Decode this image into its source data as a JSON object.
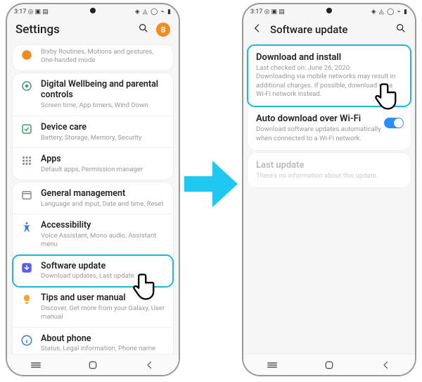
{
  "status": {
    "time": "3:17",
    "left_extra": "◎ ▣ ▤",
    "right": "◈ ◬ ◯ ⌁ ▮"
  },
  "left": {
    "title": "Settings",
    "avatar_initial": "B",
    "rows": [
      {
        "title": "Bixby Routines, Motions and gestures, One-handed mode",
        "sub": "",
        "icon": "bixby",
        "color": "#f28c1e"
      },
      {
        "title": "Digital Wellbeing and parental controls",
        "sub": "Screen time, App timers, Wind Down",
        "icon": "wellbeing",
        "color": "#3aa06e"
      },
      {
        "title": "Device care",
        "sub": "Battery, Storage, Memory, Security",
        "icon": "devicecare",
        "color": "#3aa06e"
      },
      {
        "title": "Apps",
        "sub": "Default apps, Permission manager",
        "icon": "apps",
        "color": "#8a8a8a"
      },
      {
        "title": "General management",
        "sub": "Language and input, Date and time, Reset",
        "icon": "general",
        "color": "#8a8a8a"
      },
      {
        "title": "Accessibility",
        "sub": "Voice Assistant, Mono audio, Assistant menu",
        "icon": "accessibility",
        "color": "#3a7cd6"
      },
      {
        "title": "Software update",
        "sub": "Download updates, Last update",
        "icon": "swupdate",
        "color": "#5c5cf0",
        "highlight": true
      },
      {
        "title": "Tips and user manual",
        "sub": "Discover, Get more from your Galaxy, User manual",
        "icon": "tips",
        "color": "#f5a623"
      },
      {
        "title": "About phone",
        "sub": "Status, Legal information, Phone name",
        "icon": "about",
        "color": "#3a7cd6"
      }
    ]
  },
  "right": {
    "title": "Software update",
    "rows": [
      {
        "title": "Download and install",
        "sub": "Last checked on: June 26, 2020\nDownloading via mobile networks may result in additional charges. If possible, download via a Wi-Fi network instead.",
        "highlight": true
      },
      {
        "title": "Auto download over Wi-Fi",
        "sub": "Download software updates automatically when connected to a Wi-Fi network.",
        "toggle": true
      },
      {
        "title": "Last update",
        "sub": "There's no information about this update.",
        "disabled": true
      }
    ]
  }
}
